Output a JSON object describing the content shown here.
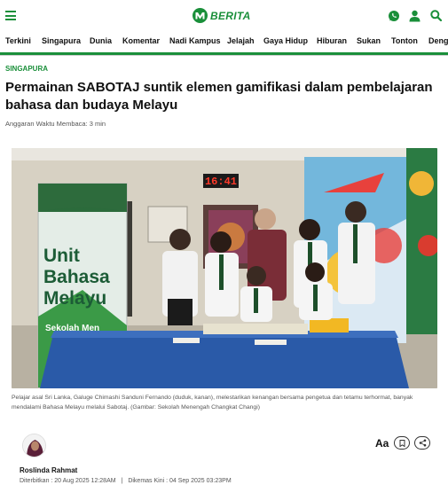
{
  "header": {
    "brand": "BERITA",
    "icons": [
      "menu-icon",
      "whatsapp-icon",
      "user-icon",
      "search-icon"
    ],
    "brand_color": "#1a8f3a"
  },
  "nav": {
    "items": [
      "Terkini",
      "Singapura",
      "Dunia",
      "Komentar",
      "Nadi Kampus",
      "Jelajah",
      "Gaya Hidup",
      "Hiburan",
      "Sukan",
      "Tonton",
      "Deng"
    ]
  },
  "article": {
    "section": "SINGAPURA",
    "headline": "Permainan SABOTAJ suntik elemen gamifikasi dalam pembelajaran bahasa dan budaya Melayu",
    "read_time": "Anggaran Waktu Membaca: 3 min",
    "photo": {
      "banner_text": "Unit Bahasa Melayu",
      "banner_sub": "Sekolah Men",
      "clock": "16:41"
    },
    "caption": "Pelajar asal Sri Lanka, Galuge Chimashi Sanduni Fernando (duduk, kanan), melestarikan kenangan bersama pengetua dan tetamu terhormat, banyak mendalami Bahasa Melayu melalui Sabotaj. (Gambar: Sekolah Menengah Changkat Changi)",
    "author": "Roslinda Rahmat",
    "published": "Diterbitkan : 20 Aug 2025 12:28AM",
    "separator": "|",
    "updated": "Dikemas Kini : 04 Sep 2025 03:23PM",
    "tools": {
      "font_label": "Aa"
    }
  }
}
